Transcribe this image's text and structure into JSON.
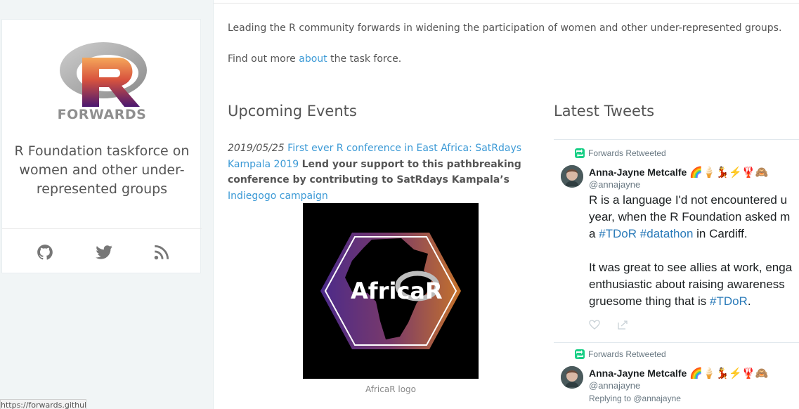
{
  "sidebar": {
    "logo_text": "FORWARDS",
    "site_title": "R Foundation taskforce on women and other under-represented groups",
    "social": {
      "github": "github-icon",
      "twitter": "twitter-icon",
      "rss": "rss-icon"
    },
    "status_url": "https://forwards.github.io/"
  },
  "intro": {
    "tagline": "Leading the R community forwards in widening the participation of women and other under-represented groups.",
    "more_prefix": "Find out more ",
    "more_link": "about",
    "more_suffix": " the task force."
  },
  "events": {
    "heading": "Upcoming Events",
    "items": [
      {
        "date": "2019/05/25",
        "title_link": "First ever R conference in East Africa: SatRdays Kampala 2019",
        "description": "Lend your support to this pathbreaking conference by contributing to SatRdays Kampala’s",
        "campaign_link": "Indiegogo campaign"
      }
    ],
    "image_caption": "AfricaR logo",
    "image_logo_text": "AfricaR"
  },
  "tweets": {
    "heading": "Latest Tweets",
    "items": [
      {
        "retweet_label": "Forwards Retweeted",
        "author": "Anna-Jayne Metcalfe",
        "emojis": "🌈🍦💃⚡🦞🙈",
        "handle": "@annajayne",
        "line1": "R is a language I'd not encountered u",
        "line2": "year, when the R Foundation asked m",
        "line3_prefix": "a ",
        "hashtag1": "#TDoR",
        "hashtag2": "#datathon",
        "line3_suffix": " in Cardiff.",
        "line4": "It was great to see allies at work, enga",
        "line5": "enthusiastic about raising awareness",
        "line6_prefix": "gruesome thing that is ",
        "hashtag3": "#TDoR",
        "line6_suffix": "."
      },
      {
        "retweet_label": "Forwards Retweeted",
        "author": "Anna-Jayne Metcalfe",
        "emojis": "🌈🍦💃⚡🦞🙈",
        "handle": "@annajayne",
        "reply_to": "Replying to @annajayne"
      }
    ]
  },
  "colors": {
    "link": "#3c9ad6",
    "sidebar_bg": "#f1f5f6",
    "retweet_green": "#19cf86",
    "tweet_link": "#2b7bb9"
  }
}
